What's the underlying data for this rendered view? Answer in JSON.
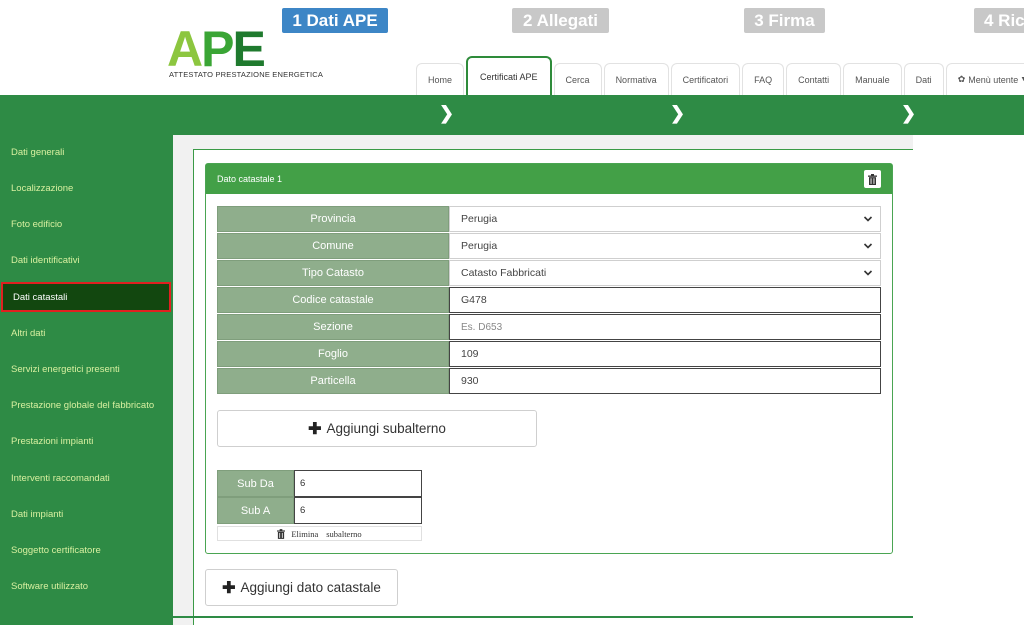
{
  "logo": {
    "letters": [
      "A",
      "P",
      "E"
    ],
    "subtitle": "ATTESTATO PRESTAZIONE ENERGETICA"
  },
  "topnav": {
    "tabs": [
      "Home",
      "Certificati APE",
      "Cerca",
      "Normativa",
      "Certificatori",
      "FAQ",
      "Contatti",
      "Manuale",
      "Dati"
    ],
    "active_tab": "Certificati APE",
    "user_menu": "Menù utente"
  },
  "wizard": {
    "steps": [
      "1 Dati APE",
      "2 Allegati",
      "3 Firma",
      "4 Ric"
    ],
    "active_step": "1 Dati APE"
  },
  "sidebar": {
    "items": [
      "Dati generali",
      "Localizzazione",
      "Foto edificio",
      "Dati identificativi",
      "Dati catastali",
      "Altri dati",
      "Servizi energetici presenti",
      "Prestazione globale del fabbricato",
      "Prestazioni impianti",
      "Interventi raccomandati",
      "Dati impianti",
      "Soggetto certificatore",
      "Software utilizzato"
    ],
    "active_item": "Dati catastali"
  },
  "card": {
    "title": "Dato catastale 1",
    "fields": [
      {
        "label": "Provincia",
        "value": "Perugia",
        "type": "select"
      },
      {
        "label": "Comune",
        "value": "Perugia",
        "type": "select"
      },
      {
        "label": "Tipo Catasto",
        "value": "Catasto Fabbricati",
        "type": "select"
      },
      {
        "label": "Codice catastale",
        "value": "G478",
        "type": "input"
      },
      {
        "label": "Sezione",
        "value": "",
        "placeholder": "Es. D653",
        "type": "input"
      },
      {
        "label": "Foglio",
        "value": "109",
        "type": "input"
      },
      {
        "label": "Particella",
        "value": "930",
        "type": "input"
      }
    ],
    "add_sub_label": "Aggiungi subalterno",
    "sub_fields": [
      {
        "label": "Sub Da",
        "value": "6"
      },
      {
        "label": "Sub A",
        "value": "6"
      }
    ],
    "elimina_word1": "Elimina",
    "elimina_word2": "subalterno"
  },
  "add_dato_label": "Aggiungi dato catastale",
  "colors": {
    "green_band": "#2e8b45",
    "card_header": "#43a047",
    "label_bg": "#8fae8c",
    "step_active": "#3d86c6",
    "sidebar_active": "#12470f"
  }
}
